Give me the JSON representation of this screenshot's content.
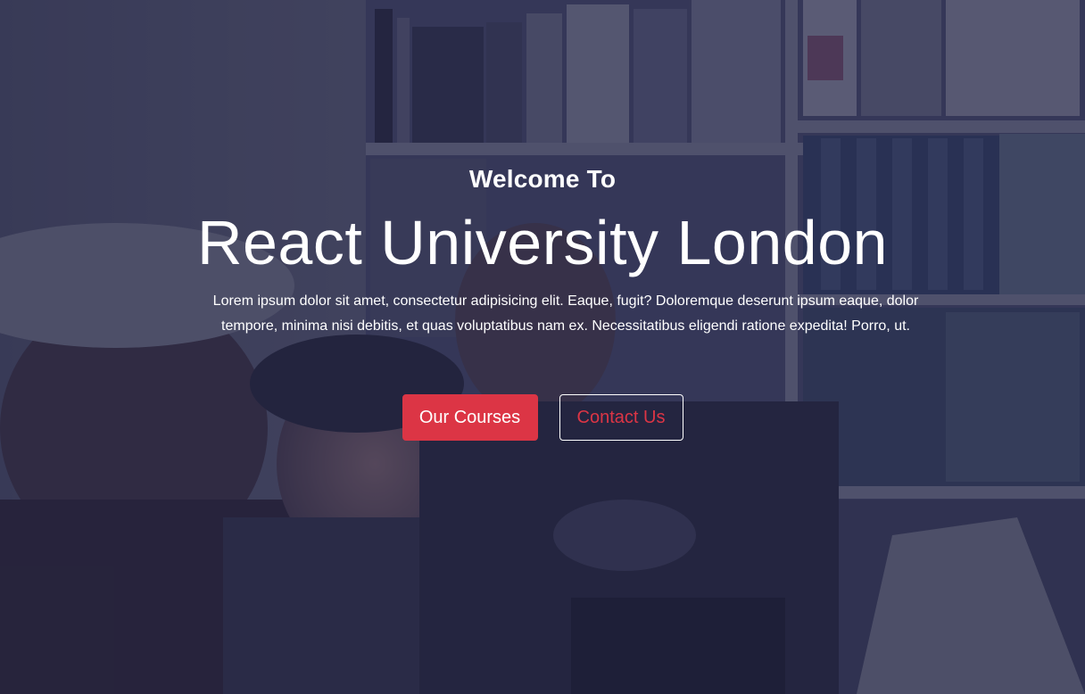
{
  "hero": {
    "welcome": "Welcome To",
    "title": "React University London",
    "description": "Lorem ipsum dolor sit amet, consectetur adipisicing elit. Eaque, fugit? Doloremque deserunt ipsum eaque, dolor tempore, minima nisi debitis, et quas voluptatibus nam ex. Necessitatibus eligendi ratione expedita! Porro, ut.",
    "primary_button": "Our Courses",
    "secondary_button": "Contact Us"
  },
  "colors": {
    "accent": "#dc3545",
    "overlay": "#1c1e3c",
    "text": "#ffffff"
  }
}
